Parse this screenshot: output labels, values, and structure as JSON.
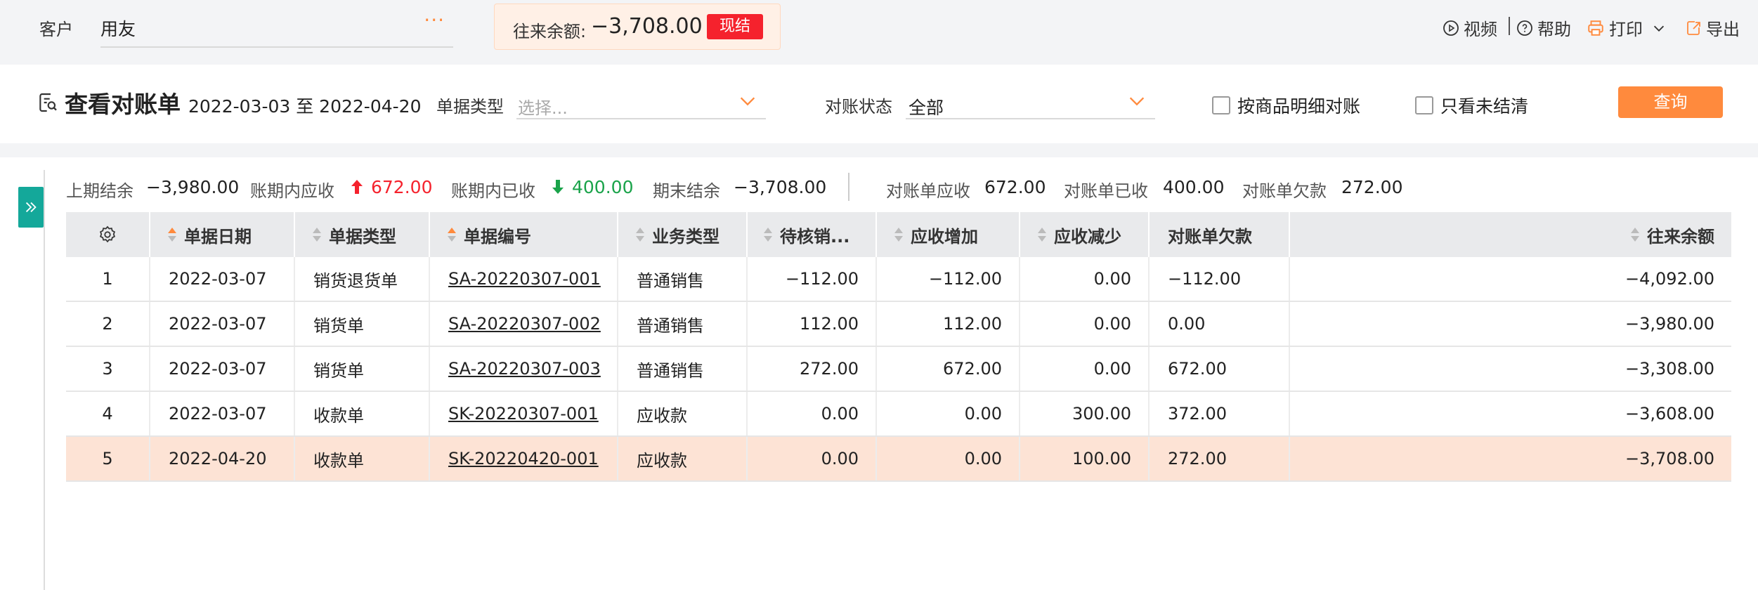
{
  "customer": {
    "label": "客户",
    "value": "用友",
    "more": "···"
  },
  "balance": {
    "label": "往来余额:",
    "value": "−3,708.00",
    "settle_label": "现结"
  },
  "tools": {
    "video": "视频",
    "help": "帮助",
    "print": "打印",
    "export": "导出"
  },
  "filter": {
    "title": "查看对账单",
    "date_range": "2022-03-03 至 2022-04-20",
    "doc_type_label": "单据类型",
    "doc_type_placeholder": "选择...",
    "status_label": "对账状态",
    "status_value": "全部",
    "check_detail": "按商品明细对账",
    "check_unsettled": "只看未结清",
    "query": "查询"
  },
  "summary": {
    "prev_label": "上期结余",
    "prev_value": "−3,980.00",
    "recv_label": "账期内应收",
    "recv_value": "672.00",
    "paid_label": "账期内已收",
    "paid_value": "400.00",
    "end_label": "期末结余",
    "end_value": "−3,708.00",
    "stmt_recv_label": "对账单应收",
    "stmt_recv_value": "672.00",
    "stmt_paid_label": "对账单已收",
    "stmt_paid_value": "400.00",
    "stmt_owe_label": "对账单欠款",
    "stmt_owe_value": "272.00"
  },
  "colors": {
    "accent": "#ff8a3d",
    "up": "#f5222d",
    "down": "#1aa34a",
    "sidebar": "#14a89a",
    "highlight": "#fde3d5"
  },
  "table": {
    "headers": [
      "单据日期",
      "单据类型",
      "单据编号",
      "业务类型",
      "待核销...",
      "应收增加",
      "应收减少",
      "对账单欠款",
      "往来余额"
    ],
    "rows": [
      [
        "1",
        "2022-03-07",
        "销货退货单",
        "SA-20220307-001",
        "普通销售",
        "−112.00",
        "−112.00",
        "0.00",
        "−112.00",
        "−4,092.00"
      ],
      [
        "2",
        "2022-03-07",
        "销货单",
        "SA-20220307-002",
        "普通销售",
        "112.00",
        "112.00",
        "0.00",
        "0.00",
        "−3,980.00"
      ],
      [
        "3",
        "2022-03-07",
        "销货单",
        "SA-20220307-003",
        "普通销售",
        "272.00",
        "672.00",
        "0.00",
        "672.00",
        "−3,308.00"
      ],
      [
        "4",
        "2022-03-07",
        "收款单",
        "SK-20220307-001",
        "应收款",
        "0.00",
        "0.00",
        "300.00",
        "372.00",
        "−3,608.00"
      ],
      [
        "5",
        "2022-04-20",
        "收款单",
        "SK-20220420-001",
        "应收款",
        "0.00",
        "0.00",
        "100.00",
        "272.00",
        "−3,708.00"
      ]
    ]
  }
}
